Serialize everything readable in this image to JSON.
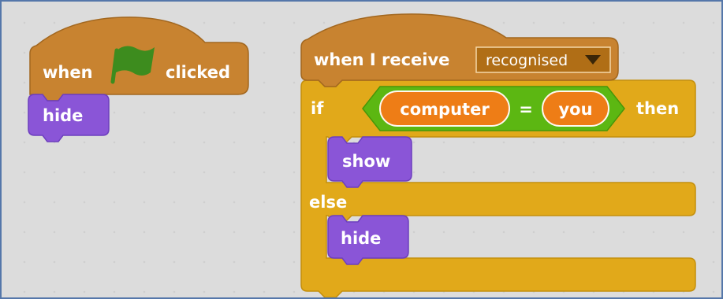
{
  "script1": {
    "hat": {
      "when": "when",
      "clicked": "clicked"
    },
    "hide": "hide"
  },
  "script2": {
    "hat": {
      "label": "when I receive",
      "message": "recognised"
    },
    "if_label": "if",
    "then_label": "then",
    "else_label": "else",
    "condition": {
      "left": "computer",
      "operator": "=",
      "right": "you"
    },
    "show": "show",
    "hide": "hide"
  },
  "colors": {
    "events": "#c88330",
    "looks": "#8a55d7",
    "control": "#e1a91a",
    "operators": "#5cb712",
    "sensing_reporter": "#ee7d16",
    "flag": "#3d8c1e"
  },
  "icons": {
    "flag": "green-flag-icon",
    "dropdown": "dropdown-arrow-icon"
  }
}
